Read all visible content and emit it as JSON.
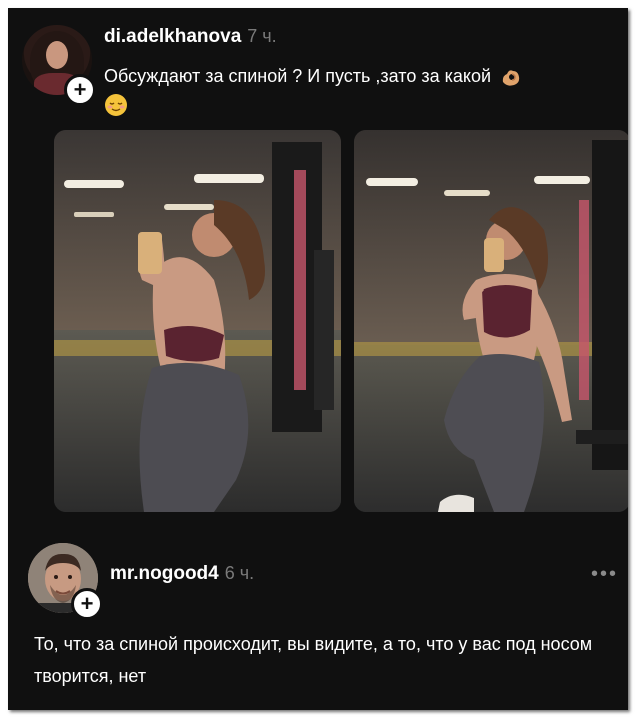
{
  "post": {
    "username": "di.adelkhanova",
    "time": "7 ч.",
    "caption": "Обсуждают за спиной ? И пусть ,зато за какой",
    "follow_symbol": "+",
    "emoji_1": "ok-hand-emoji",
    "emoji_2": "relieved-face-emoji",
    "photos": [
      "gym-mirror-selfie-back",
      "gym-mirror-selfie-front"
    ]
  },
  "reply": {
    "username": "mr.nogood4",
    "time": "6 ч.",
    "follow_symbol": "+",
    "more_label": "•••",
    "text": "То, что за спиной происходит, вы видите, а то, что у вас под носом творится, нет"
  },
  "colors": {
    "background": "#101010",
    "text": "#ffffff",
    "muted": "#7a7a7a"
  }
}
